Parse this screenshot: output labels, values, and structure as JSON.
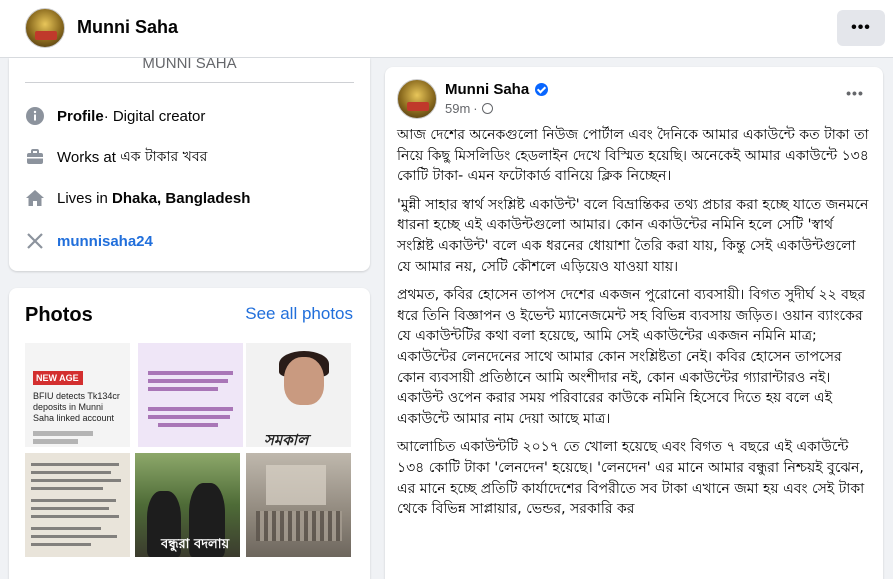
{
  "header": {
    "name": "Munni Saha",
    "more_icon": "more-horizontal-icon"
  },
  "intro": {
    "bio_text": "MUNNI SAHA",
    "rows": [
      {
        "icon": "info-icon",
        "bold": "Profile",
        "text": " · Digital creator"
      },
      {
        "icon": "briefcase-icon",
        "prefix": "Works at ",
        "text": "এক টাকার খবর"
      },
      {
        "icon": "home-icon",
        "prefix": "Lives in ",
        "bold": "Dhaka, Bangladesh"
      },
      {
        "icon": "x-logo-icon",
        "link": "munnisaha24"
      }
    ]
  },
  "photos": {
    "title": "Photos",
    "see_all": "See all photos",
    "p1_headline": "NEW AGE",
    "p1_caption": "BFIU detects Tk134cr deposits in Munni Saha linked account",
    "p3_masthead": "সমকাল",
    "p5_caption": "বন্ধুরা বদলায়"
  },
  "post": {
    "author": "Munni Saha",
    "time": "59m",
    "separator": "·",
    "paragraphs": [
      "আজ দেশের অনেকগুলো নিউজ পোর্টাল এবং দৈনিকে আমার একাউন্টে কত টাকা তা নিয়ে কিছু মিসলিডিং হেডলাইন দেখে বিস্মিত হয়েছি। অনেকেই আমার একাউন্টে ১৩৪ কোটি টাকা- এমন ফটোকার্ড বানিয়ে ক্লিক নিচ্ছেন।",
      "'মুন্নী সাহার স্বার্থ সংশ্লিষ্ট একাউন্ট' বলে বিভ্রান্তিকর তথ্য প্রচার করা হচ্ছে যাতে জনমনে ধারনা হচ্ছে এই একাউন্টগুলো আমার। কোন একাউন্টের নমিনি হলে সেটি 'স্বার্থ সংশ্লিষ্ট একাউন্ট' বলে এক ধরনের ধোয়াশা তৈরি করা যায়, কিন্তু সেই একাউন্টগুলো যে আমার নয়, সেটি কৌশলে এড়িয়েও যাওয়া যায়।",
      "প্রথমত, কবির হোসেন তাপস দেশের একজন পুরোনো ব্যবসায়ী। বিগত সুদীর্ঘ ২২ বছর ধরে তিনি বিজ্ঞাপন ও ইভেন্ট ম্যানেজমেন্ট সহ বিভিন্ন ব্যবসায় জড়িত। ওয়ান ব্যাংকের যে একাউন্টটির কথা বলা হয়েছে, আমি সেই একাউন্টের একজন নমিনি মাত্র; একাউন্টের লেনদেনের সাথে আমার কোন সংশ্লিষ্টতা নেই। কবির হোসেন তাপসের কোন ব্যবসায়ী প্রতিষ্ঠানে আমি অংশীদার নই, কোন একাউন্টের গ্যারান্টারও নই। একাউন্ট ওপেন করার সময় পরিবারের কাউকে নমিনি হিসেবে দিতে হয় বলে এই একাউন্টে আমার নাম দেয়া আছে মাত্র।",
      "আলোচিত একাউন্টটি ২০১৭ তে খোলা হয়েছে এবং বিগত ৭ বছরে এই একাউন্টে ১৩৪ কোটি টাকা 'লেনদেন' হয়েছে। 'লেনদেন' এর মানে আমার বন্ধুরা নিশ্চয়ই বুঝেন, এর মানে হচ্ছে প্রতিটি কার্যাদেশের বিপরীতে সব টাকা এখানে জমা হয় এবং সেই টাকা থেকে বিভিন্ন সাপ্লায়ার, ভেন্ডর, সরকারি কর"
    ]
  }
}
